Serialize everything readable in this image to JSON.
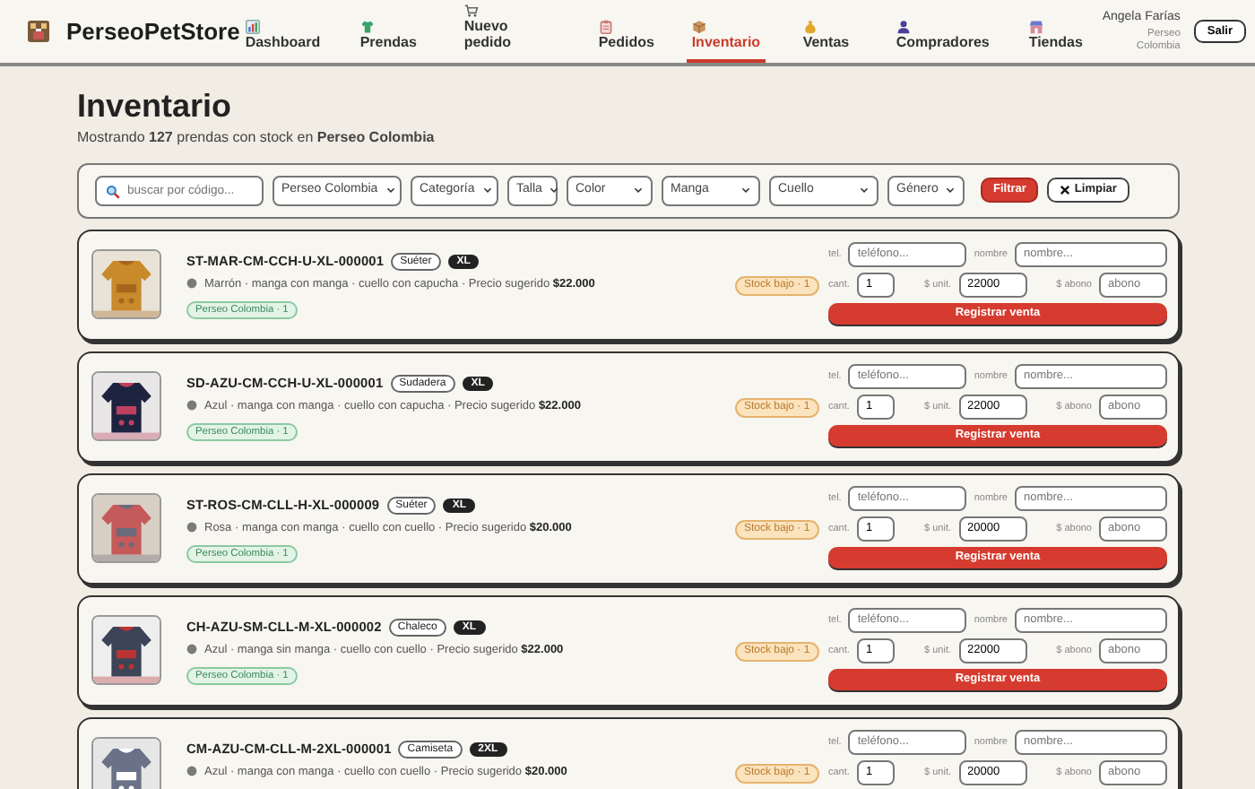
{
  "brand": "PerseoPetStore",
  "nav": [
    {
      "label": "Dashboard",
      "selected": false
    },
    {
      "label": "Prendas",
      "selected": false
    },
    {
      "label": "Nuevo pedido",
      "selected": false
    },
    {
      "label": "Pedidos",
      "selected": false
    },
    {
      "label": "Inventario",
      "selected": true
    },
    {
      "label": "Ventas",
      "selected": false
    },
    {
      "label": "Compradores",
      "selected": false
    },
    {
      "label": "Tiendas",
      "selected": false
    }
  ],
  "user": {
    "name": "Angela Farías",
    "store": "Perseo Colombia",
    "logout": "Salir"
  },
  "page": {
    "title": "Inventario",
    "subtitle": "Mostrando **127** prendas con stock en **Perseo Colombia**"
  },
  "filters": {
    "search": {
      "placeholder": "buscar por código..."
    },
    "selects": [
      {
        "value": "Perseo Colombia"
      },
      {
        "value": "Categoría"
      },
      {
        "value": "Talla"
      },
      {
        "value": "Color"
      },
      {
        "value": "Manga"
      },
      {
        "value": "Cuello"
      },
      {
        "value": "Género"
      }
    ],
    "apply": "Filtrar",
    "clear": "Limpiar"
  },
  "items": [
    {
      "code": "ST-MAR-CM-CCH-U-XL-000001",
      "category": "Suéter",
      "size": "XL",
      "details": "Marrón · manga con manga · cuello con capucha · Precio sugerido **$22.000**",
      "store_tag": "Perseo Colombia · 1",
      "stock": "Stock bajo · 1",
      "sale": {
        "tel_label": "tel.",
        "tel_placeholder": "teléfono...",
        "name_label": "nombre",
        "name_placeholder": "nombre...",
        "qty_label": "cant.",
        "qty": "1",
        "unit_label": "$ unit.",
        "unit": "22000",
        "deposit_label": "$ abono",
        "deposit_placeholder": "abono",
        "button": "Registrar venta"
      }
    },
    {
      "code": "SD-AZU-CM-CCH-U-XL-000001",
      "category": "Sudadera",
      "size": "XL",
      "details": "Azul · manga con manga · cuello con capucha · Precio sugerido **$22.000**",
      "store_tag": "Perseo Colombia · 1",
      "stock": "Stock bajo · 1",
      "sale": {
        "tel_label": "tel.",
        "tel_placeholder": "teléfono...",
        "name_label": "nombre",
        "name_placeholder": "nombre...",
        "qty_label": "cant.",
        "qty": "1",
        "unit_label": "$ unit.",
        "unit": "22000",
        "deposit_label": "$ abono",
        "deposit_placeholder": "abono",
        "button": "Registrar venta"
      }
    },
    {
      "code": "ST-ROS-CM-CLL-H-XL-000009",
      "category": "Suéter",
      "size": "XL",
      "details": "Rosa · manga con manga · cuello con cuello · Precio sugerido **$20.000**",
      "store_tag": "Perseo Colombia · 1",
      "stock": "Stock bajo · 1",
      "sale": {
        "tel_label": "tel.",
        "tel_placeholder": "teléfono...",
        "name_label": "nombre",
        "name_placeholder": "nombre...",
        "qty_label": "cant.",
        "qty": "1",
        "unit_label": "$ unit.",
        "unit": "20000",
        "deposit_label": "$ abono",
        "deposit_placeholder": "abono",
        "button": "Registrar venta"
      }
    },
    {
      "code": "CH-AZU-SM-CLL-M-XL-000002",
      "category": "Chaleco",
      "size": "XL",
      "details": "Azul · manga sin manga · cuello con cuello · Precio sugerido **$22.000**",
      "store_tag": "Perseo Colombia · 1",
      "stock": "Stock bajo · 1",
      "sale": {
        "tel_label": "tel.",
        "tel_placeholder": "teléfono...",
        "name_label": "nombre",
        "name_placeholder": "nombre...",
        "qty_label": "cant.",
        "qty": "1",
        "unit_label": "$ unit.",
        "unit": "22000",
        "deposit_label": "$ abono",
        "deposit_placeholder": "abono",
        "button": "Registrar venta"
      }
    },
    {
      "code": "CM-AZU-CM-CLL-M-2XL-000001",
      "category": "Camiseta",
      "size": "2XL",
      "details": "Azul · manga con manga · cuello con cuello · Precio sugerido **$20.000**",
      "stock": "Stock bajo · 1",
      "sale": {
        "tel_label": "tel.",
        "tel_placeholder": "teléfono...",
        "name_label": "nombre",
        "name_placeholder": "nombre...",
        "qty_label": "cant.",
        "qty": "1",
        "unit_label": "$ unit.",
        "unit": "20000",
        "deposit_label": "$ abono",
        "deposit_placeholder": "abono"
      }
    }
  ]
}
